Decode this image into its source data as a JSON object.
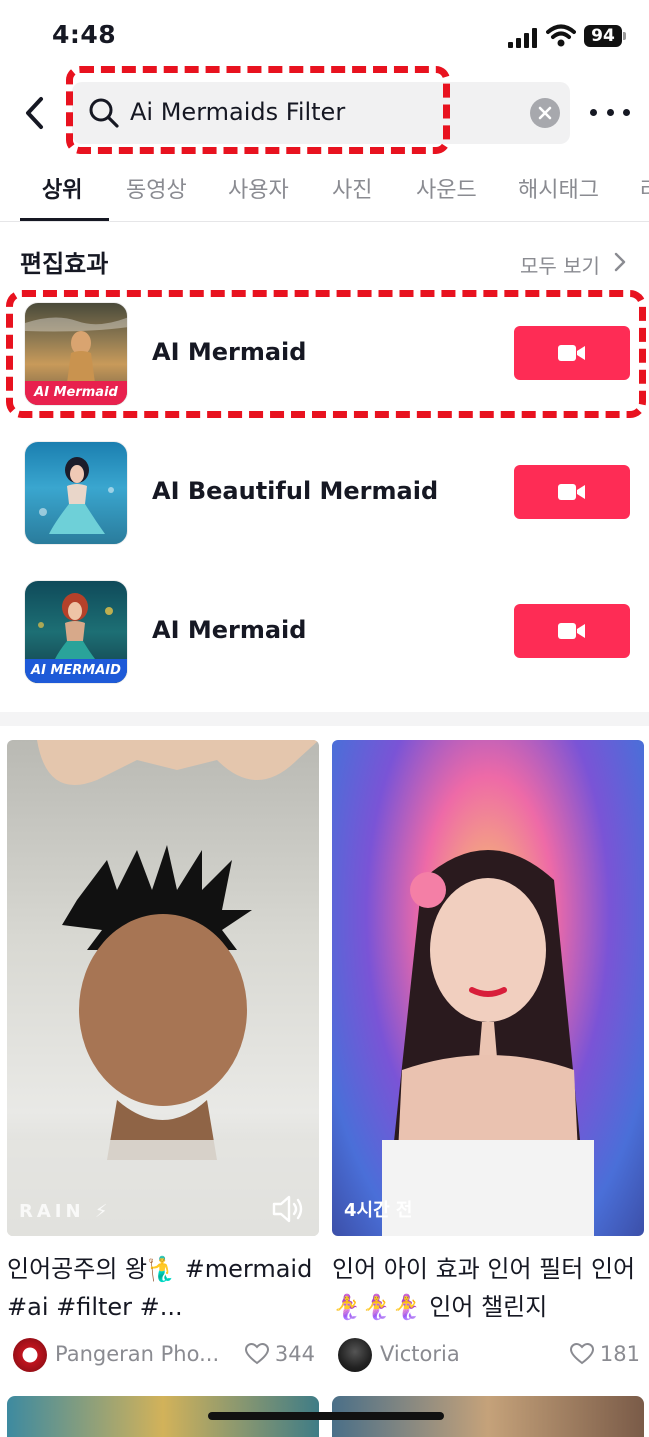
{
  "status": {
    "time": "4:48",
    "battery": "94"
  },
  "search": {
    "query": "Ai Mermaids Filter"
  },
  "tabs": [
    {
      "label": "상위",
      "active": true
    },
    {
      "label": "동영상"
    },
    {
      "label": "사용자"
    },
    {
      "label": "사진"
    },
    {
      "label": "사운드"
    },
    {
      "label": "해시태그"
    },
    {
      "label": "라"
    }
  ],
  "effects_section": {
    "title": "편집효과",
    "see_all": "모두 보기",
    "items": [
      {
        "name": "AI Mermaid",
        "thumb_label": "AI Mermaid"
      },
      {
        "name": "AI Beautiful Mermaid",
        "thumb_label": ""
      },
      {
        "name": "AI Mermaid",
        "thumb_label": "AI MERMAID"
      }
    ]
  },
  "videos": [
    {
      "caption": "인어공주의 왕🧜‍♂️ #mermaid #ai #filter #...",
      "overlay": "RAIN ⚡",
      "author": "Pangeran Pho...",
      "likes": "344"
    },
    {
      "caption": "인어 아이 효과 인어 필터 인어 🧜‍♀️🧜‍♀️🧜‍♀️ 인어 챌린지",
      "overlay": "4시간 전",
      "author": "Victoria",
      "likes": "181"
    }
  ],
  "colors": {
    "accent": "#fe2c55",
    "highlight": "#e8121f"
  }
}
